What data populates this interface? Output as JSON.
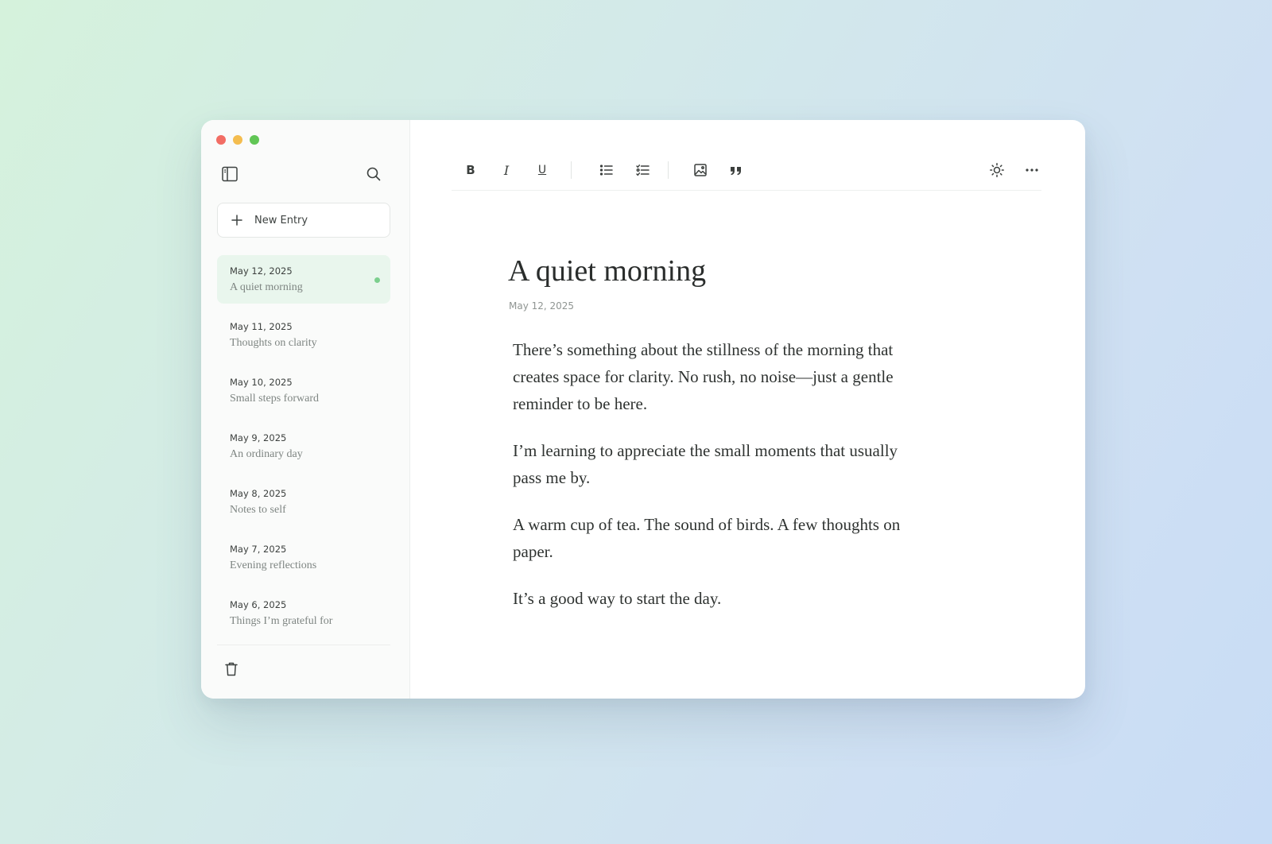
{
  "window": {
    "traffic_lights": {
      "close_color": "#f26d64",
      "minimize_color": "#f4bd4f",
      "maximize_color": "#61c655"
    }
  },
  "sidebar": {
    "toggle_icon": "sidebar-panel-icon",
    "search_icon": "search-icon",
    "new_entry_label": "New Entry",
    "new_entry_icon": "plus-icon",
    "accent_color": "#7ccf8e",
    "active_bg_color": "#e9f6ed",
    "entries": [
      {
        "date": "May 12, 2025",
        "title": "A quiet morning",
        "active": true
      },
      {
        "date": "May 11, 2025",
        "title": "Thoughts on clarity",
        "active": false
      },
      {
        "date": "May 10, 2025",
        "title": "Small steps forward",
        "active": false
      },
      {
        "date": "May 9, 2025",
        "title": "An ordinary day",
        "active": false
      },
      {
        "date": "May 8, 2025",
        "title": "Notes to self",
        "active": false
      },
      {
        "date": "May 7, 2025",
        "title": "Evening reflections",
        "active": false
      },
      {
        "date": "May 6, 2025",
        "title": "Things I’m grateful for",
        "active": false
      }
    ],
    "trash_icon": "trash-icon"
  },
  "toolbar": {
    "bold_label": "B",
    "italic_label": "I",
    "underline_label": "U",
    "icons": [
      "bold-icon",
      "italic-icon",
      "underline-icon",
      "bulleted-list-icon",
      "checklist-icon",
      "image-icon",
      "quote-icon",
      "sun-icon",
      "more-icon"
    ]
  },
  "document": {
    "title": "A quiet morning",
    "date": "May 12, 2025",
    "paragraphs": [
      "There’s something about the stillness of the morning that creates space for clarity. No rush, no noise—just a gentle reminder to be here.",
      "I’m learning to appreciate the small moments that usually pass me by.",
      "A warm cup of tea. The sound of birds. A few thoughts on paper.",
      "It’s a good way to start the day."
    ]
  }
}
